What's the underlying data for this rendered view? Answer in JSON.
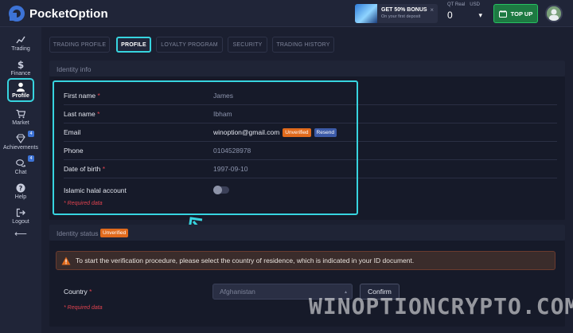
{
  "header": {
    "logo_text": "PocketOption",
    "bonus_title": "GET 50% BONUS",
    "bonus_sub": "On your first deposit",
    "bonus_close": "×",
    "account_type": "QT Real",
    "currency": "USD",
    "balance": "0",
    "balance_caret": "▾",
    "topup_label": "TOP UP"
  },
  "sidebar": {
    "items": [
      {
        "label": "Trading",
        "icon": "chart-icon"
      },
      {
        "label": "Finance",
        "icon": "dollar-icon"
      },
      {
        "label": "Profile",
        "icon": "user-icon"
      },
      {
        "label": "Market",
        "icon": "cart-icon",
        "badge": ""
      },
      {
        "label": "Achievements",
        "icon": "diamond-icon",
        "badge": "4"
      },
      {
        "label": "Chat",
        "icon": "chat-icon",
        "badge": "4"
      },
      {
        "label": "Help",
        "icon": "help-icon"
      },
      {
        "label": "Logout",
        "icon": "logout-icon"
      }
    ],
    "collapse": "⟵"
  },
  "tabs": [
    "TRADING PROFILE",
    "PROFILE",
    "LOYALTY PROGRAM",
    "SECURITY",
    "TRADING HISTORY"
  ],
  "identity": {
    "title": "Identity info",
    "first_name_label": "First name",
    "first_name": "James",
    "last_name_label": "Last name",
    "last_name": "Ibham",
    "email_label": "Email",
    "email": "winoption@gmail.com",
    "email_status": "Unverified",
    "resend_label": "Resend",
    "phone_label": "Phone",
    "phone": "0104528978",
    "dob_label": "Date of birth",
    "dob": "1997-09-10",
    "islamic_label": "Islamic halal account",
    "required_star": "*",
    "required_note": "* Required data"
  },
  "status": {
    "title": "Identity status",
    "badge": "Unverified",
    "alert": "To start the verification procedure, please select the country of residence, which is indicated in your ID document.",
    "country_label": "Country",
    "country_value": "Afghanistan",
    "confirm_label": "Confirm",
    "required_note": "* Required data"
  },
  "watermark": "WINOPTIONCRYPTO.COM",
  "colors": {
    "accent_highlight": "#37d4df",
    "topup_green": "#27c062",
    "unverified_orange": "#e06a1c",
    "resend_blue": "#3c5ba8",
    "required_red": "#e0434f"
  }
}
